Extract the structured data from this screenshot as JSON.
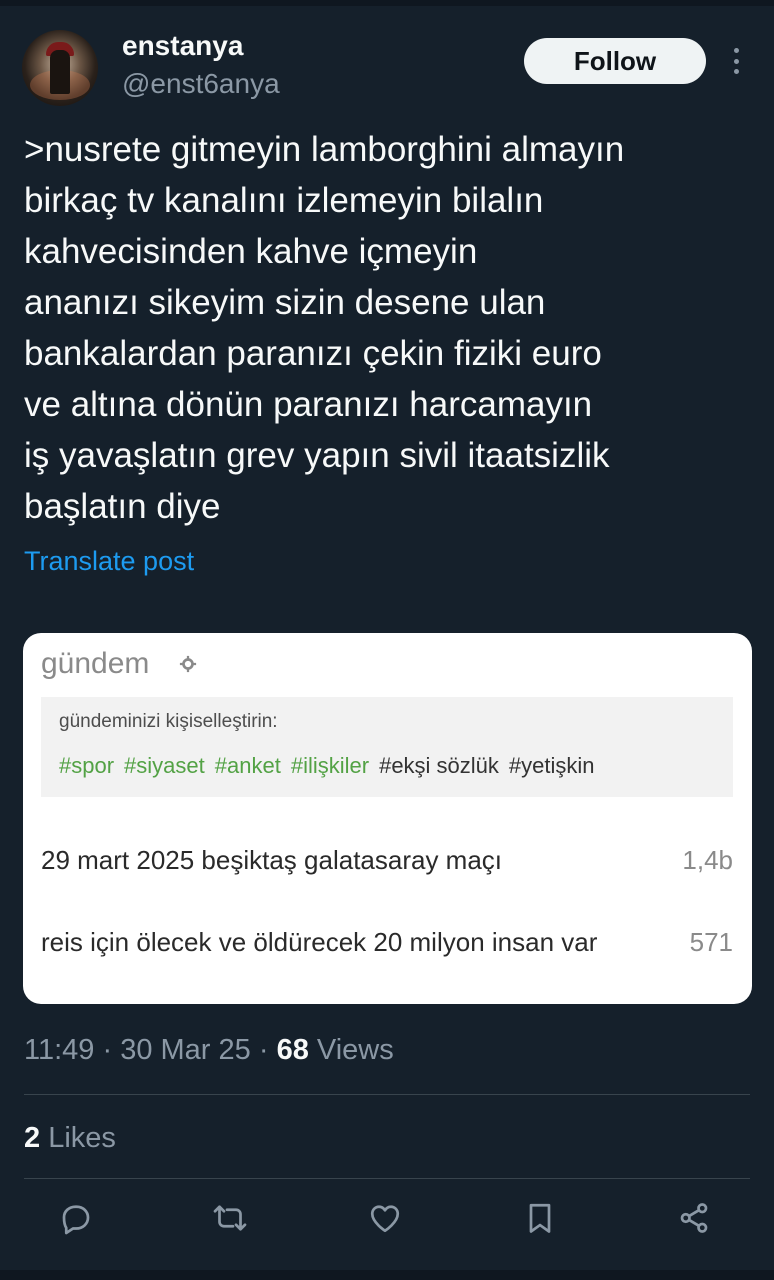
{
  "author": {
    "display_name": "enstanya",
    "handle": "@enst6anya"
  },
  "follow_label": "Follow",
  "post": {
    "text": ">nusrete gitmeyin lamborghini almayın\nbirkaç tv kanalını izlemeyin bilalın\nkahvecisinden kahve içmeyin\nananızı sikeyim sizin desene ulan\nbankalardan paranızı çekin fiziki euro\nve altına dönün paranızı harcamayın\niş yavaşlatın grev yapın sivil itaatsizlik\nbaşlatın diye",
    "translate_label": "Translate post"
  },
  "embed": {
    "title": "gündem",
    "personalize_label": "gündeminizi kişiselleştirin:",
    "tags": [
      "#spor",
      "#siyaset",
      "#anket",
      "#ilişkiler",
      "#ekşi sözlük",
      "#yetişkin"
    ],
    "rows": [
      {
        "text": "29 mart 2025 beşiktaş galatasaray maçı",
        "count": "1,4b"
      },
      {
        "text": "reis için ölecek ve öldürecek 20 milyon insan var",
        "count": "571"
      }
    ]
  },
  "meta": {
    "time": "11:49",
    "date": "30 Mar 25",
    "views_count": "68",
    "views_label": "Views"
  },
  "likes": {
    "count": "2",
    "label": "Likes"
  },
  "icons": {
    "reply": "reply-icon",
    "repost": "repost-icon",
    "like": "like-icon",
    "bookmark": "bookmark-icon",
    "share": "share-icon",
    "more": "more-icon",
    "gear": "gear-icon"
  },
  "colors": {
    "background": "#15202b",
    "accent": "#1d9bf0",
    "muted": "#8b98a5",
    "tag_green": "#53a245"
  }
}
